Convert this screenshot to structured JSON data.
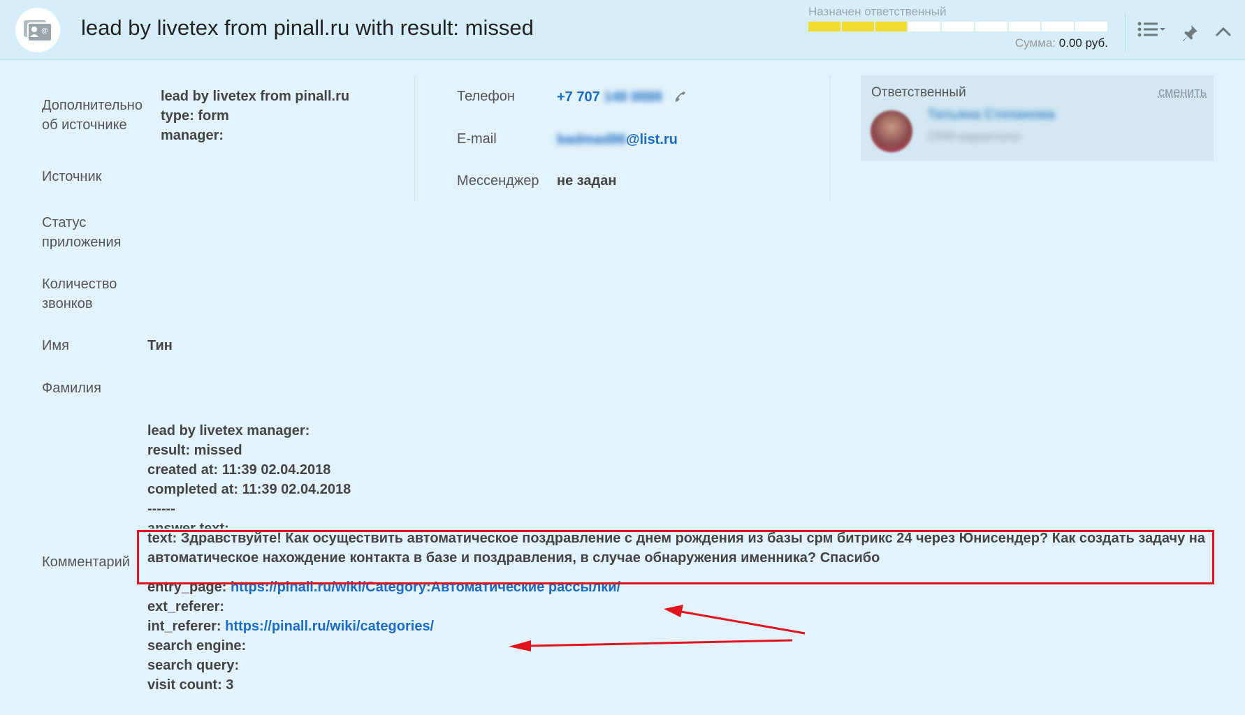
{
  "header": {
    "title": "lead by livetex from pinall.ru with result: missed",
    "status_label": "Назначен ответственный",
    "progress": {
      "total_stages": 9,
      "filled_stages": 3,
      "color": "#f2dc2e"
    },
    "sum_label": "Сумма:",
    "sum_value": "0.00 руб."
  },
  "fields_left": {
    "source_info_label": "Дополнительно об источнике",
    "source_info_lines": [
      "lead by livetex from pinall.ru",
      "type: form",
      "manager:"
    ],
    "source_label": "Источник",
    "app_status_label": "Статус приложения",
    "call_count_label": "Количество звонков",
    "name_label": "Имя",
    "name_value": "Тин",
    "surname_label": "Фамилия",
    "comment_label": "Комментарий"
  },
  "contacts": {
    "phone_label": "Телефон",
    "phone_prefix": "+7 707",
    "phone_hidden": "148 8888",
    "email_label": "E-mail",
    "email_hidden": "badmad88",
    "email_domain": "@list.ru",
    "messenger_label": "Мессенджер",
    "messenger_value": "не задан"
  },
  "responsible": {
    "title": "Ответственный",
    "change_label": "сменить",
    "name": "Татьяна Степанова",
    "position": "CRM-маркетолог"
  },
  "comment": {
    "line1": "lead by livetex manager:",
    "line2": "result: missed",
    "line3": "created at: 11:39 02.04.2018",
    "line4": "completed at: 11:39 02.04.2018",
    "line5": "------",
    "line6": "answer text:",
    "question": "text: Здравствуйте! Как осуществить автоматическое поздравление с днем рождения из базы срм битрикс 24 через Юнисендер? Как создать задачу на автоматическое нахождение контакта в базе и поздравления, в случае обнаружения именника? Спасибо",
    "entry_page_label": "entry_page:",
    "entry_page_url": "https://pinall.ru/wiki/Category:Автоматические рассылки/",
    "ext_referer_label": "ext_referer:",
    "int_referer_label": "int_referer:",
    "int_referer_url": "https://pinall.ru/wiki/categories/",
    "search_engine_label": "search engine:",
    "search_query_label": "search query:",
    "visit_count": "visit count: 3"
  },
  "colors": {
    "annotation_red": "#e0141e",
    "link_blue": "#1b6cc4",
    "background": "#e3f3fb"
  },
  "icons": [
    "contact-card-icon",
    "call-icon",
    "list-menu-icon",
    "pin-icon",
    "collapse-chevron-icon"
  ]
}
